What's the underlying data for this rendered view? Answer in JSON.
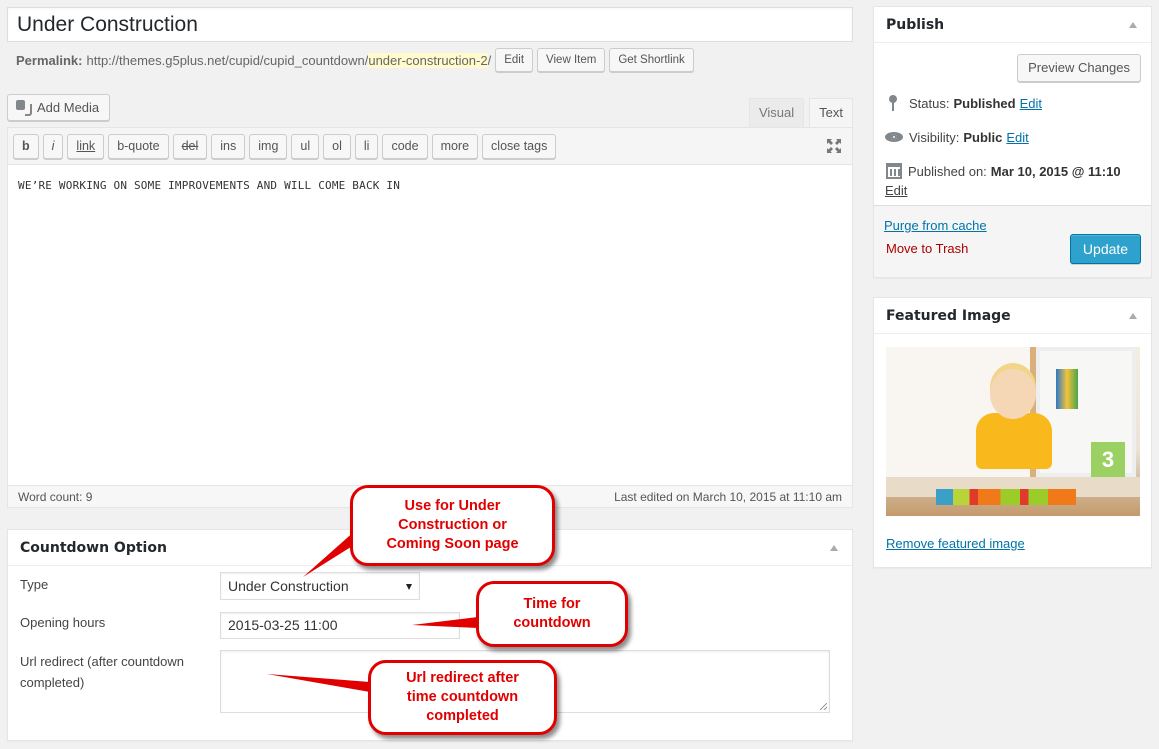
{
  "post": {
    "title": "Under Construction",
    "permalink_label": "Permalink:",
    "permalink_base": "http://themes.g5plus.net/cupid/cupid_countdown/",
    "permalink_slug": "under-construction-2",
    "permalink_trailing": "/",
    "permalink_buttons": {
      "edit": "Edit",
      "view": "View Item",
      "shortlink": "Get Shortlink"
    }
  },
  "editor": {
    "add_media": "Add Media",
    "tabs": {
      "visual": "Visual",
      "text": "Text",
      "active": "Text"
    },
    "quicktags": [
      "b",
      "i",
      "link",
      "b-quote",
      "del",
      "ins",
      "img",
      "ul",
      "ol",
      "li",
      "code",
      "more",
      "close tags"
    ],
    "content": "WE’RE WORKING ON SOME IMPROVEMENTS AND WILL COME BACK IN",
    "word_count": "Word count: 9",
    "last_edited": "Last edited on March 10, 2015 at 11:10 am"
  },
  "countdown": {
    "title": "Countdown Option",
    "type_label": "Type",
    "type_value": "Under Construction",
    "opening_label": "Opening hours",
    "opening_value": "2015-03-25 11:00",
    "redirect_label_1": "Url redirect (after countdown",
    "redirect_label_2": "completed)",
    "redirect_value": ""
  },
  "publish": {
    "title": "Publish",
    "preview": "Preview Changes",
    "status_label": "Status:",
    "status_value": "Published",
    "visibility_label": "Visibility:",
    "visibility_value": "Public",
    "published_label": "Published on:",
    "published_value": "Mar 10, 2015 @ 11:10",
    "edit": "Edit",
    "purge": "Purge from cache",
    "trash": "Move to Trash",
    "update": "Update"
  },
  "featured": {
    "title": "Featured Image",
    "image_alt": "Toddler playing with colorful blocks",
    "block_number": "3",
    "remove": "Remove featured image"
  },
  "callouts": {
    "type_note": [
      "Use for Under",
      "Construction or",
      "Coming Soon page"
    ],
    "time_note": [
      "Time for",
      "countdown"
    ],
    "redirect_note": [
      "Url redirect after",
      "time countdown",
      "completed"
    ],
    "color": "#e00000"
  }
}
